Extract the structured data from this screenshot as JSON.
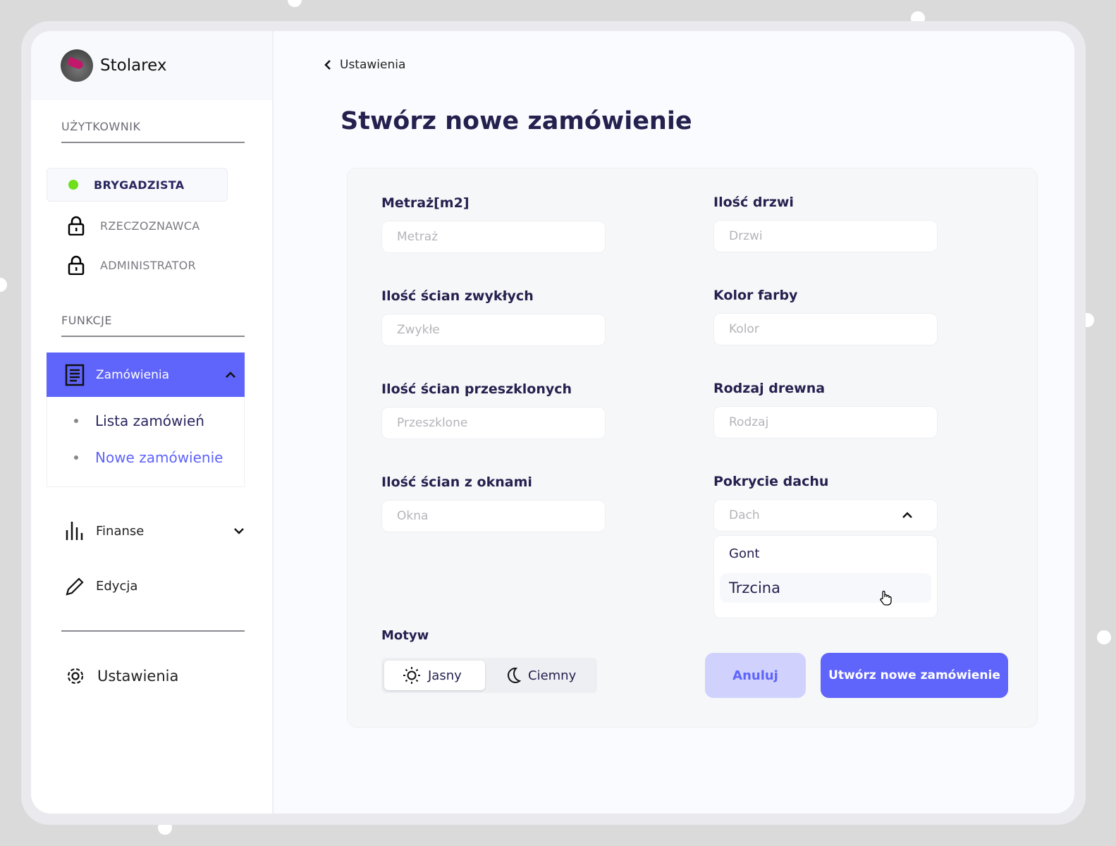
{
  "app": {
    "name": "Stolarex"
  },
  "sidebar": {
    "user_section": "UŻYTKOWNIK",
    "roles": [
      {
        "label": "BRYGADZISTA",
        "status": "active"
      },
      {
        "label": "RZECZOZNAWCA",
        "status": "locked"
      },
      {
        "label": "ADMINISTRATOR",
        "status": "locked"
      }
    ],
    "functions_section": "FUNKCJE",
    "orders": {
      "label": "Zamówienia",
      "items": [
        "Lista zamówień",
        "Nowe zamówienie"
      ]
    },
    "finance": "Finanse",
    "edit": "Edycja",
    "settings": "Ustawienia"
  },
  "header": {
    "back_label": "Ustawienia",
    "title": "Stwórz nowe zamówienie"
  },
  "form": {
    "fields": [
      {
        "label": "Metraż[m2]",
        "placeholder": "Metraż"
      },
      {
        "label": "Ilość drzwi",
        "placeholder": "Drzwi"
      },
      {
        "label": "Ilość ścian zwykłych",
        "placeholder": "Zwykłe"
      },
      {
        "label": "Kolor farby",
        "placeholder": "Kolor"
      },
      {
        "label": "Ilość ścian przeszklonych",
        "placeholder": "Przeszklone"
      },
      {
        "label": "Rodzaj drewna",
        "placeholder": "Rodzaj"
      },
      {
        "label": "Ilość ścian z oknami",
        "placeholder": "Okna"
      },
      {
        "label": "Pokrycie dachu",
        "placeholder": "Dach"
      }
    ],
    "roof_options": [
      "Gont",
      "Trzcina"
    ],
    "theme_label": "Motyw",
    "theme_light": "Jasny",
    "theme_dark": "Ciemny",
    "cancel": "Anuluj",
    "submit": "Utwórz nowe zamówienie"
  },
  "colors": {
    "accent": "#5f64fb",
    "accent_light": "#d0d2fd",
    "text": "#24214f",
    "active": "#6de01b"
  }
}
